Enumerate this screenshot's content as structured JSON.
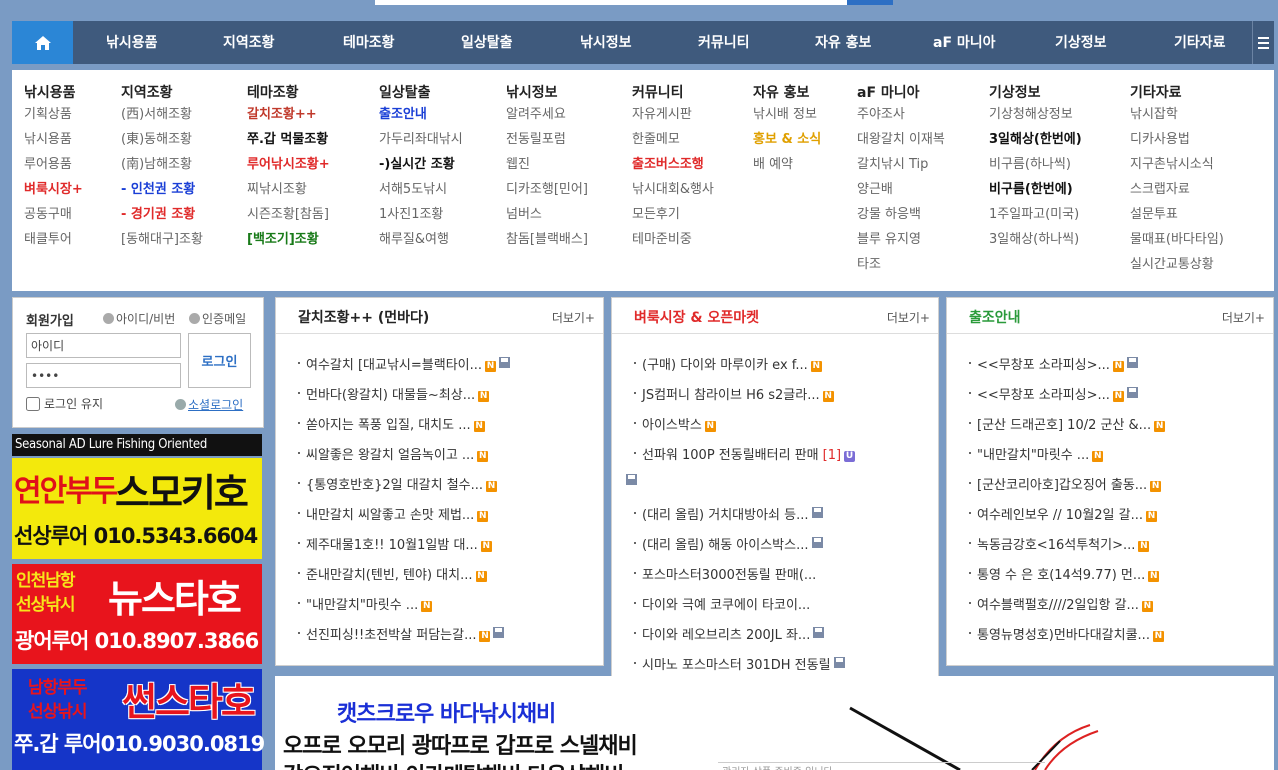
{
  "nav": {
    "items": [
      "낚시용품",
      "지역조황",
      "테마조황",
      "일상탈출",
      "낚시정보",
      "커뮤니티",
      "자유 홍보",
      "aF 마니아",
      "기상정보",
      "기타자료"
    ]
  },
  "mega": [
    {
      "title": "낚시용품",
      "items": [
        "기획상품",
        "낚시용품",
        "루어용품",
        "벼룩시장+",
        "공동구매",
        "태클투어"
      ]
    },
    {
      "title": "지역조황",
      "items": [
        "(西)서해조황",
        "(東)동해조황",
        "(南)남해조황",
        "- 인천권 조황",
        "- 경기권 조황",
        "[동해대구]조황"
      ]
    },
    {
      "title": "테마조황",
      "items": [
        "갈치조황++",
        "쭈.갑 먹물조황",
        "루어낚시조황+",
        "찌낚시조황",
        "시즌조황[참돔]",
        "[백조기]조황"
      ]
    },
    {
      "title": "일상탈출",
      "items": [
        "출조안내",
        "가두리좌대낚시",
        "-)실시간 조황",
        "서해5도낚시",
        "1사진1조황",
        "해루질&여행"
      ]
    },
    {
      "title": "낚시정보",
      "items": [
        "알려주세요",
        "전동릴포럼",
        "웹진",
        "디카조행[민어]",
        "넘버스",
        "참돔[블랙배스]"
      ]
    },
    {
      "title": "커뮤니티",
      "items": [
        "자유게시판",
        "한줄메모",
        "출조버스조행",
        "낚시대회&행사",
        "모든후기",
        "테마준비중"
      ]
    },
    {
      "title": "자유 홍보",
      "items": [
        "낚시배 정보",
        "홍보 & 소식",
        "배 예약"
      ]
    },
    {
      "title": "aF 마니아",
      "items": [
        "주야조사",
        "대왕갈치 이재복",
        "갈치낚시 Tip",
        "양근배",
        "강물 하응백",
        "블루 유지영",
        "타조"
      ]
    },
    {
      "title": "기상정보",
      "items": [
        "기상청해상정보",
        "3일해상(한번에)",
        "비구름(하나씩)",
        "비구름(한번에)",
        "1주일파고(미국)",
        "3일해상(하나씩)"
      ]
    },
    {
      "title": "기타자료",
      "items": [
        "낚시잡학",
        "디카사용법",
        "지구촌낚시소식",
        "스크랩자료",
        "설문투표",
        "물때표(바다타임)",
        "실시간교통상황"
      ]
    }
  ],
  "login": {
    "title": "회원가입",
    "find": "아이디/비번",
    "email": "인증메일",
    "id_value": "아이디",
    "pw_value": "••••",
    "button": "로그인",
    "keep": "로그인 유지",
    "social": "소셜로그인"
  },
  "ads": {
    "strip": "Seasonal AD Lure Fishing Oriented",
    "ad1": {
      "top": "연안부두",
      "name": "스모키호",
      "tag": "선상루어",
      "phone": "010.5343.6604"
    },
    "ad2": {
      "top": "인천남항",
      "mid": "선상낚시",
      "name": "뉴스타호",
      "tag": "광어루어",
      "phone": "010.8907.3866"
    },
    "ad3": {
      "top": "남항부두",
      "mid": "선상낚시",
      "name": "썬스타호",
      "tag": "쭈.갑 루어",
      "phone": "010.9030.0819"
    }
  },
  "panels": [
    {
      "title": "갈치조황++ (먼바다)",
      "more": "더보기+",
      "items": [
        {
          "t": "여수갈치 [대교낚시=블랙타이...",
          "n": true,
          "f": true
        },
        {
          "t": "먼바다(왕갈치) 대물들~최상...",
          "n": true
        },
        {
          "t": "쏟아지는 폭풍 입질, 대치도 ...",
          "n": true
        },
        {
          "t": "씨알좋은 왕갈치 얼음녹이고 ...",
          "n": true
        },
        {
          "t": "{통영호반호}2일 대갈치 철수...",
          "n": true
        },
        {
          "t": "내만갈치 씨알좋고 손맛 제법...",
          "n": true
        },
        {
          "t": "제주대물1호!! 10월1일밤 대...",
          "n": true
        },
        {
          "t": "준내만갈치(텐빈, 텐야) 대치...",
          "n": true
        },
        {
          "t": "\"내만갈치\"마릿수 ...",
          "n": true
        },
        {
          "t": "선진피싱!!초전박살 퍼담는갈...",
          "n": true,
          "f": true
        }
      ]
    },
    {
      "title": "벼룩시장 & 오픈마켓",
      "more": "더보기+",
      "items": [
        {
          "t": "(구매) 다이와 마루이카 ex f...",
          "n": true
        },
        {
          "t": "JS컴퍼니 참라이브 H6 s2글라...",
          "n": true
        },
        {
          "t": "아이스박스",
          "n": true
        },
        {
          "t": "선파워 100P 전동릴배터리 판매",
          "c": "[1]",
          "u": true
        },
        {
          "t": "",
          "f": true
        },
        {
          "t": "(대리 올림) 거치대방아쇠 등...",
          "f": true
        },
        {
          "t": "(대리 올림) 해동 아이스박스...",
          "f": true
        },
        {
          "t": "포스마스터3000전동릴 판매(..."
        },
        {
          "t": "다이와 극예 코쿠에이 타코이..."
        },
        {
          "t": "다이와 레오브리츠 200JL 좌...",
          "f": true
        },
        {
          "t": "시마노 포스마스터 301DH 전동릴",
          "f": true
        }
      ]
    },
    {
      "title": "출조안내",
      "more": "더보기+",
      "items": [
        {
          "t": "<<무창포 소라피싱>...",
          "n": true,
          "f": true
        },
        {
          "t": "<<무창포 소라피싱>...",
          "n": true,
          "f": true
        },
        {
          "t": "[군산 드래곤호] 10/2 군산 &...",
          "n": true
        },
        {
          "t": "\"내만갈치\"마릿수 ...",
          "n": true
        },
        {
          "t": "[군산코리아호]갑오징어 출동...",
          "n": true
        },
        {
          "t": "여수레인보우 // 10월2일 갈...",
          "n": true
        },
        {
          "t": "녹동금강호<16석투척기>...",
          "n": true
        },
        {
          "t": "통영 수 은 호(14석9.77) 먼...",
          "n": true
        },
        {
          "t": "여수블랙펄호////2일입항 갈...",
          "n": true
        },
        {
          "t": "통영뉴명성호)먼바다대갈치쿨...",
          "n": true
        }
      ]
    }
  ],
  "banner": {
    "l1": "캣츠크로우 바다낚시채비",
    "l2": "오프로 오모리 광따프로 갑프로 스넬채비",
    "l3": "갑오징어채비 이카메탈채비 다운샷채비",
    "note": "관리자 상품 준비중 입니다"
  },
  "colors": {
    "nav": "#3f5a7d",
    "home": "#2b86d6",
    "bg": "#7a9bc4",
    "accent": "#e02a2a"
  }
}
